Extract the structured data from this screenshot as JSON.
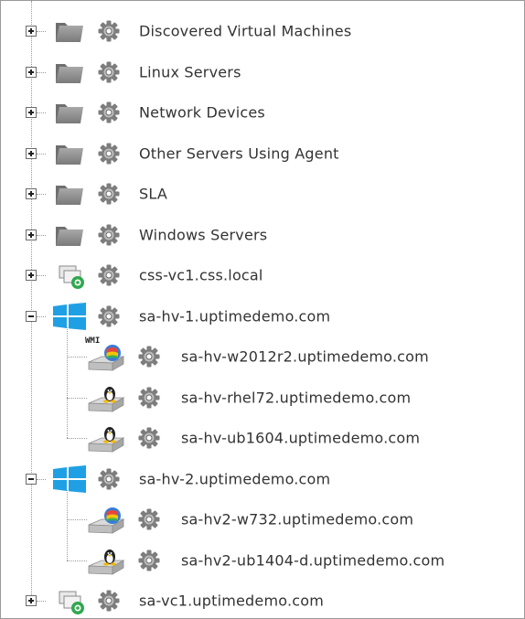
{
  "tree": {
    "items": [
      {
        "label": "Discovered Virtual Machines",
        "type": "group",
        "expanded": false,
        "level": 0
      },
      {
        "label": "Linux Servers",
        "type": "group",
        "expanded": false,
        "level": 0
      },
      {
        "label": "Network Devices",
        "type": "group",
        "expanded": false,
        "level": 0
      },
      {
        "label": "Other Servers Using Agent",
        "type": "group",
        "expanded": false,
        "level": 0
      },
      {
        "label": "SLA",
        "type": "group",
        "expanded": false,
        "level": 0
      },
      {
        "label": "Windows Servers",
        "type": "group",
        "expanded": false,
        "level": 0
      },
      {
        "label": "css-vc1.css.local",
        "type": "vcenter",
        "expanded": false,
        "level": 0
      },
      {
        "label": "sa-hv-1.uptimedemo.com",
        "type": "hyperv",
        "expanded": true,
        "level": 0
      },
      {
        "label": "sa-hv-w2012r2.uptimedemo.com",
        "type": "vm-windows-wmi",
        "level": 1,
        "badge": "WMI"
      },
      {
        "label": "sa-hv-rhel72.uptimedemo.com",
        "type": "vm-linux",
        "level": 1
      },
      {
        "label": "sa-hv-ub1604.uptimedemo.com",
        "type": "vm-linux",
        "level": 1
      },
      {
        "label": "sa-hv-2.uptimedemo.com",
        "type": "hyperv",
        "expanded": true,
        "level": 0
      },
      {
        "label": "sa-hv2-w732.uptimedemo.com",
        "type": "vm-windows",
        "level": 1
      },
      {
        "label": "sa-hv2-ub1404-d.uptimedemo.com",
        "type": "vm-linux",
        "level": 1
      },
      {
        "label": "sa-vc1.uptimedemo.com",
        "type": "vcenter",
        "expanded": false,
        "level": 0
      }
    ]
  },
  "colors": {
    "text": "#333333",
    "folder": "#8c8c8c",
    "gear": "#7d7d7d",
    "windows": "#1fa0e4",
    "vcenter_badge": "#2fa84f"
  }
}
